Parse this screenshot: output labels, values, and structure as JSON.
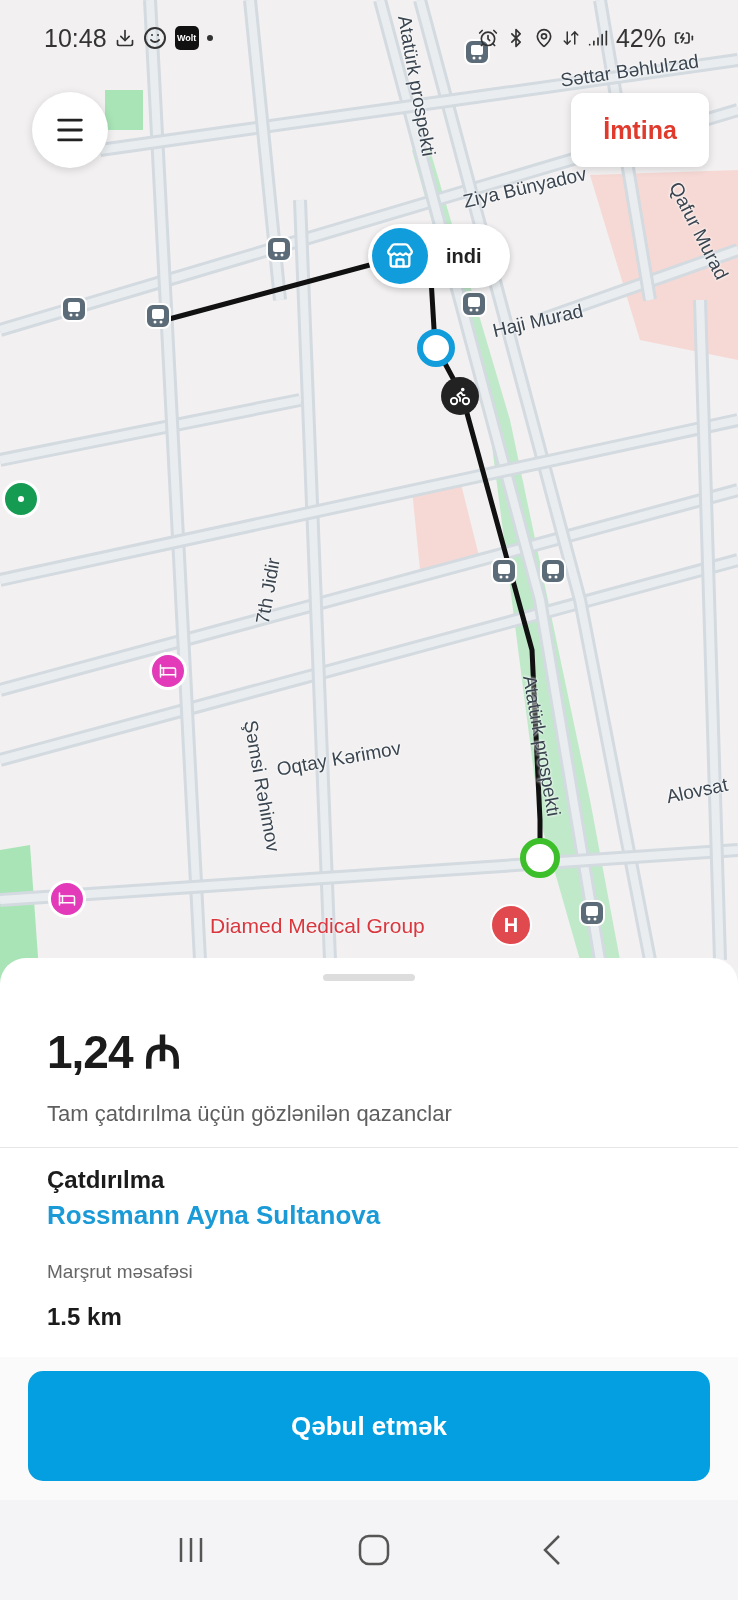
{
  "status_bar": {
    "time": "10:48",
    "app_badge": "Wolt",
    "battery": "42%"
  },
  "map": {
    "streets": [
      {
        "name": "Atatürk prospekti"
      },
      {
        "name": "Səttar Bəhlulzad"
      },
      {
        "name": "Ziya Bünyadov"
      },
      {
        "name": "Qafur Murad"
      },
      {
        "name": "Haji Murad"
      },
      {
        "name": "7th Jidir"
      },
      {
        "name": "Şəmsi Rəhimov"
      },
      {
        "name": "Oqtay Kərimov"
      },
      {
        "name": "Atatürk prospekti"
      },
      {
        "name": "Alovsat"
      }
    ],
    "pickup_pin": {
      "label": "indi"
    },
    "poi": {
      "name": "Diamed Medical Group",
      "marker": "H"
    }
  },
  "top_bar": {
    "cancel_button": "İmtina"
  },
  "sheet": {
    "amount": "1,24 ₼",
    "amount_note": "Tam çatdırılma üçün gözlənilən qazanclar",
    "section_title": "Çatdırılma",
    "store": "Rossmann Ayna Sultanova",
    "distance_label": "Marşrut məsafəsi",
    "distance": "1.5 km",
    "accept_button": "Qəbul etmək"
  }
}
